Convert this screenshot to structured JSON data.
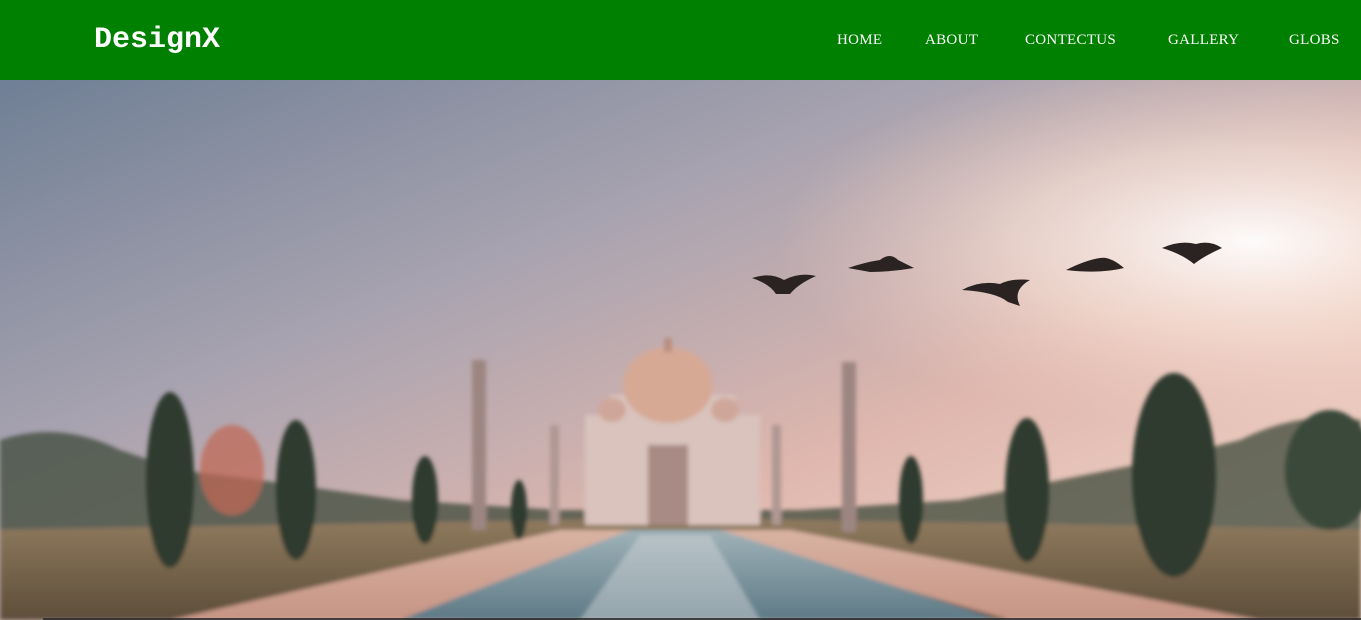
{
  "brand": {
    "name": "DesignX"
  },
  "nav": {
    "items": [
      {
        "label": "HOME",
        "name": "nav-link-home"
      },
      {
        "label": "ABOUT",
        "name": "nav-link-about"
      },
      {
        "label": "CONTECTUS",
        "name": "nav-link-contectus"
      },
      {
        "label": "GALLERY",
        "name": "nav-link-gallery"
      },
      {
        "label": "GLOBS",
        "name": "nav-link-globs"
      }
    ]
  },
  "colors": {
    "navbar_bg": "#008000",
    "nav_text": "#ffffff"
  },
  "hero": {
    "image_subject": "taj-mahal-sunset-with-birds"
  }
}
